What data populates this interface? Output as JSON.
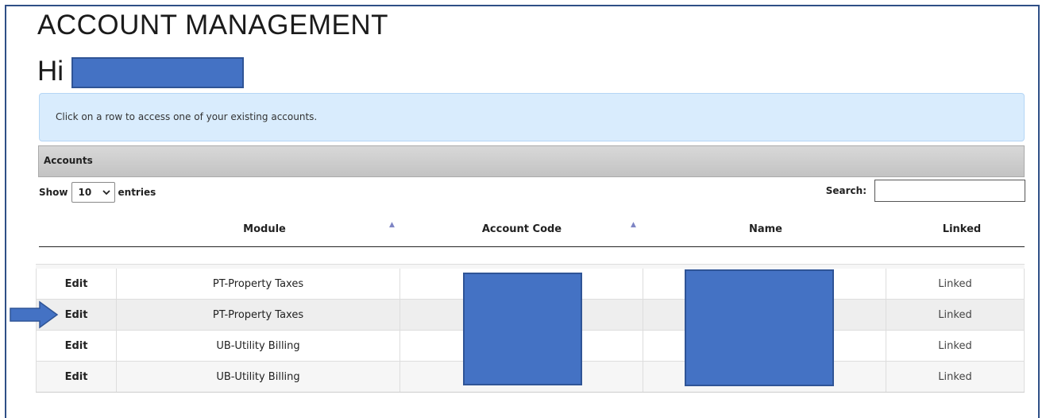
{
  "page": {
    "title": "ACCOUNT MANAGEMENT",
    "greeting": "Hi"
  },
  "info": {
    "message": "Click on a row to access one of your existing accounts."
  },
  "panel": {
    "title": "Accounts"
  },
  "controls": {
    "show_label": "Show",
    "entries_value": "10",
    "entries_label": "entries",
    "search_label": "Search:",
    "search_value": ""
  },
  "table": {
    "headers": [
      "Module",
      "Account Code",
      "Name",
      "Linked"
    ],
    "rows": [
      {
        "edit": "Edit",
        "module": "PT-Property Taxes",
        "linked": "Linked"
      },
      {
        "edit": "Edit",
        "module": "PT-Property Taxes",
        "linked": "Linked"
      },
      {
        "edit": "Edit",
        "module": "UB-Utility Billing",
        "linked": "Linked"
      },
      {
        "edit": "Edit",
        "module": "UB-Utility Billing",
        "linked": "Linked"
      }
    ]
  },
  "colors": {
    "redaction": "#4472c4",
    "info_bg": "#d9ecfd",
    "highlight_row": "#eeeeee"
  },
  "icons": {
    "sort": "sort-asc-icon",
    "dropdown": "chevron-down-icon",
    "annotation": "arrow-right-icon"
  }
}
